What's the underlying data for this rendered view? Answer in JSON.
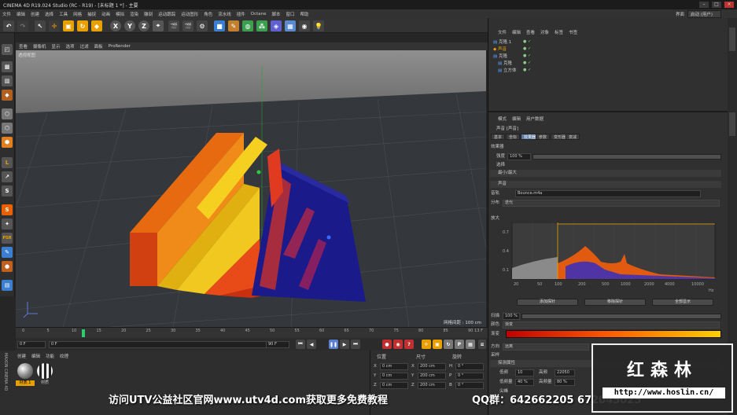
{
  "app": {
    "title": "CINEMA 4D R19.024 Studio (RC - R19) - [未标题 1 *] - 主要",
    "menu": [
      "文件",
      "编辑",
      "创建",
      "选择",
      "工具",
      "网格",
      "捕捉",
      "动画",
      "模拟",
      "渲染",
      "雕刻",
      "运动跟踪",
      "运动图形",
      "角色",
      "流水线",
      "插件",
      "Octane",
      "脚本",
      "窗口",
      "帮助"
    ],
    "layout_label": "界面",
    "layout_value": "启动 (用户)"
  },
  "viewport": {
    "menu": [
      "查看",
      "摄像机",
      "显示",
      "选项",
      "过滤",
      "面板",
      "ProRender"
    ],
    "label": "透视视图",
    "grid_spacing": "网格间距 : 100 cm"
  },
  "timeline": {
    "ticks": [
      "0",
      "5",
      "10",
      "15",
      "20",
      "25",
      "30",
      "35",
      "40",
      "45",
      "50",
      "55",
      "60",
      "65",
      "70",
      "75",
      "80",
      "85",
      "90"
    ],
    "frame_right": "13 F",
    "start": "0 F",
    "current": "0 F",
    "end": "90 F",
    "end2": "90 F"
  },
  "material_panel": {
    "menu": [
      "创建",
      "编辑",
      "功能",
      "纹理"
    ],
    "materials": [
      "材质.1",
      "材质"
    ]
  },
  "coord_panel": {
    "headers": [
      "位置",
      "尺寸",
      "旋转"
    ],
    "rows": [
      {
        "axis": "X",
        "pos": "0 cm",
        "size_axis": "X",
        "size": "200 cm",
        "rot_axis": "H",
        "rot": "0 °"
      },
      {
        "axis": "Y",
        "pos": "0 cm",
        "size_axis": "Y",
        "size": "200 cm",
        "rot_axis": "P",
        "rot": "0 °"
      },
      {
        "axis": "Z",
        "pos": "0 cm",
        "size_axis": "Z",
        "size": "200 cm",
        "rot_axis": "B",
        "rot": "0 °"
      }
    ]
  },
  "object_manager": {
    "menu": [
      "文件",
      "编辑",
      "查看",
      "对象",
      "标签",
      "书签"
    ],
    "objects": [
      "克隆.1",
      "声音",
      "克隆",
      "克隆",
      "立方体"
    ]
  },
  "attributes": {
    "menu": [
      "模式",
      "编辑",
      "用户数据"
    ],
    "object_label": "声音 [声音]",
    "tabs": [
      "基本",
      "坐标",
      "效果器",
      "参数",
      "变形器",
      "衰减"
    ],
    "effector_label": "效果器",
    "strength_label": "强度",
    "strength_value": "100 %",
    "select_label": "选择",
    "minmax_label": "最小/最大",
    "sound_section": "声音",
    "track_label": "音轨",
    "track_value": "Bounce.m4a",
    "distribution_label": "分布",
    "distribution_value": "迭代",
    "graph_y_label": "放大",
    "graph_y_ticks": [
      "0.7",
      "0.4",
      "0.1"
    ],
    "graph_x_ticks": [
      "20",
      "50",
      "100",
      "200",
      "500",
      "1000",
      "2000",
      "4000",
      "10000"
    ],
    "graph_x_unit": "Hz",
    "buttons": [
      "添加探针",
      "移除探针",
      "全部显示"
    ],
    "gain_label": "扫描",
    "gain_value": "100 %",
    "filter_label": "颜色",
    "filter_value": "渐变",
    "gradient_label": "渐变",
    "direction_label": "方向",
    "direction_value": "远离",
    "sampling_label": "采样",
    "filter_section": "探测属性",
    "low_label": "低频",
    "low_value": "10",
    "high_label": "高频",
    "high_value": "22050",
    "lowfreq_label": "低频量",
    "lowfreq_value": "40 %",
    "highfreq_label": "高频量",
    "highfreq_value": "80 %",
    "spike_label": "尖峰"
  },
  "overlay": {
    "caption_left": "访问UTV公益社区官网www.utv4d.com获取更多免费教程",
    "caption_right": "QQ群：642662205  672045025",
    "logo_text": "红森林",
    "logo_url": "http://www.hoslin.cn/"
  }
}
